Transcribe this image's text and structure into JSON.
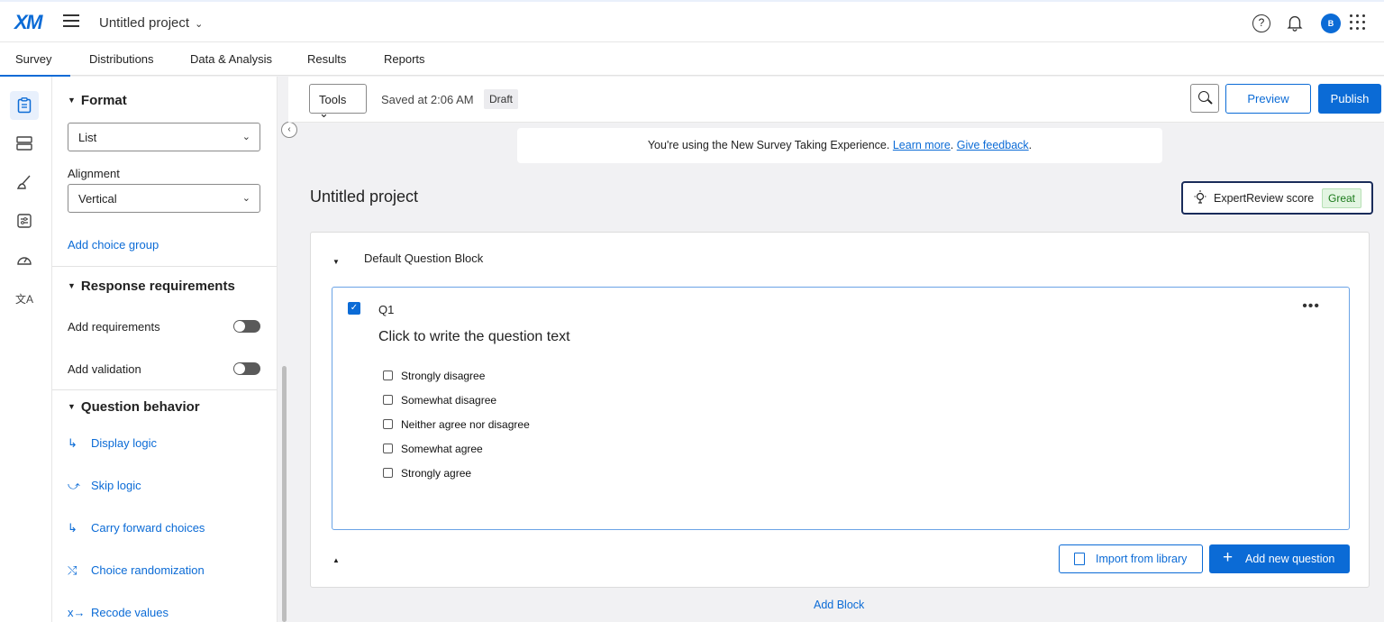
{
  "header": {
    "logo": "XM",
    "project_title": "Untitled project",
    "avatar_initial": "B"
  },
  "nav_tabs": [
    {
      "label": "Survey",
      "active": true
    },
    {
      "label": "Distributions"
    },
    {
      "label": "Data & Analysis"
    },
    {
      "label": "Results"
    },
    {
      "label": "Reports"
    }
  ],
  "rail_icons": [
    "survey-clipboard-icon",
    "blocks-icon",
    "brush-icon",
    "survey-options-icon",
    "gauge-icon",
    "translate-icon"
  ],
  "panel": {
    "format": {
      "title": "Format",
      "format_value": "List",
      "alignment_label": "Alignment",
      "alignment_value": "Vertical",
      "add_choice_group": "Add choice group"
    },
    "response": {
      "title": "Response requirements",
      "add_requirements": "Add requirements",
      "add_validation": "Add validation"
    },
    "behavior": {
      "title": "Question behavior",
      "display_logic": "Display logic",
      "skip_logic": "Skip logic",
      "carry_forward": "Carry forward choices",
      "randomization": "Choice randomization",
      "recode": "Recode values"
    }
  },
  "toolbar": {
    "tools": "Tools",
    "saved": "Saved at 2:06 AM",
    "draft": "Draft",
    "preview": "Preview",
    "publish": "Publish"
  },
  "notice": {
    "text": "You're using the New Survey Taking Experience. ",
    "learn_more": "Learn more",
    "separator": ". ",
    "give_feedback": "Give feedback",
    "end": "."
  },
  "main": {
    "title": "Untitled project",
    "expert_label": "ExpertReview score",
    "expert_score": "Great"
  },
  "block": {
    "title": "Default Question Block",
    "question": {
      "number": "Q1",
      "text": "Click to write the question text",
      "choices": [
        "Strongly disagree",
        "Somewhat disagree",
        "Neither agree nor disagree",
        "Somewhat agree",
        "Strongly agree"
      ]
    },
    "import_label": "Import from library",
    "add_question_label": "Add new question"
  },
  "add_block": "Add Block"
}
